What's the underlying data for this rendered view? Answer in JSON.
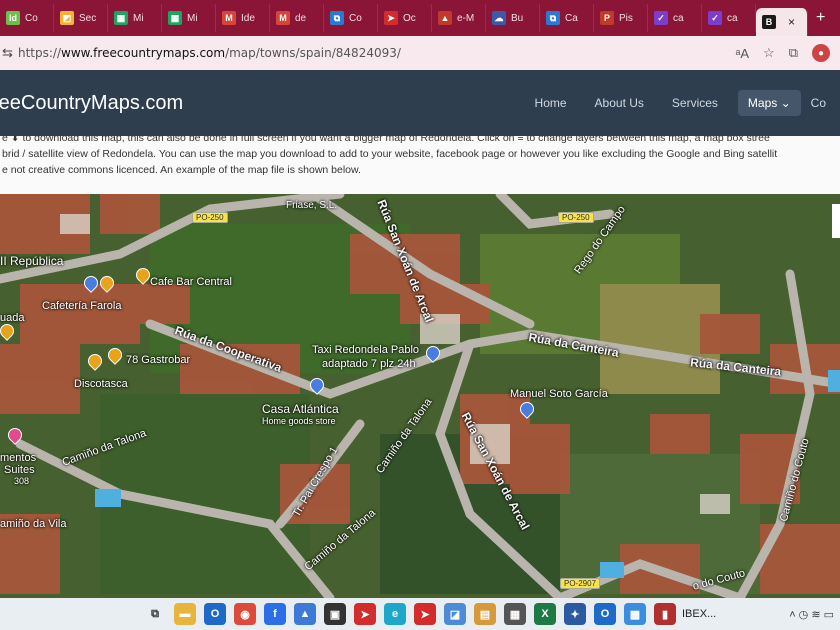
{
  "browser": {
    "tabs": [
      {
        "label": "Co",
        "fav": "Id",
        "color": "#6bbf4a"
      },
      {
        "label": "Sec",
        "fav": "◩",
        "color": "#f2b233"
      },
      {
        "label": "Mi",
        "fav": "▦",
        "color": "#1fa463"
      },
      {
        "label": "Mi",
        "fav": "▦",
        "color": "#1fa463"
      },
      {
        "label": "Ide",
        "fav": "M",
        "color": "#d64537"
      },
      {
        "label": "de",
        "fav": "M",
        "color": "#d64537"
      },
      {
        "label": "Co",
        "fav": "⧉",
        "color": "#2b79d0"
      },
      {
        "label": "Oc",
        "fav": "➤",
        "color": "#d22c2c"
      },
      {
        "label": "e-M",
        "fav": "▲",
        "color": "#c0392b"
      },
      {
        "label": "Bu",
        "fav": "☁",
        "color": "#3d5aa8"
      },
      {
        "label": "Ca",
        "fav": "⧉",
        "color": "#2b79d0"
      },
      {
        "label": "Pis",
        "fav": "P",
        "color": "#c0392b"
      },
      {
        "label": "ca",
        "fav": "✓",
        "color": "#7d3cc9"
      },
      {
        "label": "ca",
        "fav": "✓",
        "color": "#7d3cc9"
      },
      {
        "label": "",
        "fav": "B",
        "color": "#1a1a1a"
      }
    ],
    "new_tab": "+",
    "close": "×",
    "url_domain": "www.freecountrymaps.com",
    "url_prefix": "https://",
    "url_path": "/map/towns/spain/84824093/"
  },
  "site": {
    "brand": "reeCountryMaps.com",
    "nav": [
      "Home",
      "About Us",
      "Services",
      "Maps ⌄",
      "Co"
    ]
  },
  "intro": {
    "line1": "e ⬇ to download this map, this can also be done in full screen if you want a bigger map of Redondela. Click on ≡ to change layers between this map, a map box stree",
    "line2": "brid / satellite view of Redondela. You can use the map you download to add to your website, facebook page or however you like excluding the Google and Bing satellit",
    "line3": "e not creative commons licenced. An example of the map file is shown below."
  },
  "map": {
    "labels": {
      "republica": "II República",
      "cafe_central": "Cafe Bar Central",
      "cafeteria": "Cafetería Farola",
      "uada": "uada",
      "gastrobar": "78 Gastrobar",
      "discotasca": "Discotasca",
      "cooperativa": "Rúa da Cooperativa",
      "casa_atlantica": "Casa Atlántica",
      "home_goods": "Home goods store",
      "taxi": "Taxi Redondela Pablo",
      "taxi2": "adaptado 7 plz 24h",
      "canteira1": "Rúa da Canteira",
      "canteira2": "Rúa da Canteira",
      "manuel": "Manuel Soto García",
      "san_xoan1": "Rúa San Xoán de Arcal",
      "san_xoan2": "Rúa San Xoán de Arcal",
      "talona1": "Camiño da Talona",
      "talona2": "Camiño da Talona",
      "talona3": "Camiño da Talona",
      "pai_crespo": "Tr. Pai Crespo 1",
      "rego": "Rego do Campo",
      "friase": "Friase, S.L.",
      "couto": "Camiño do Couto",
      "couto2": "o do Couto",
      "vila": "amiño da Vila",
      "mentos": "mentos",
      "suites": "Suites",
      "n308": "308"
    },
    "badges": [
      "PO-250",
      "PO-250",
      "PO-2907"
    ]
  },
  "taskbar": {
    "ibex": "IBEX...",
    "tray": "˄  ◷  ≋  ▭"
  }
}
